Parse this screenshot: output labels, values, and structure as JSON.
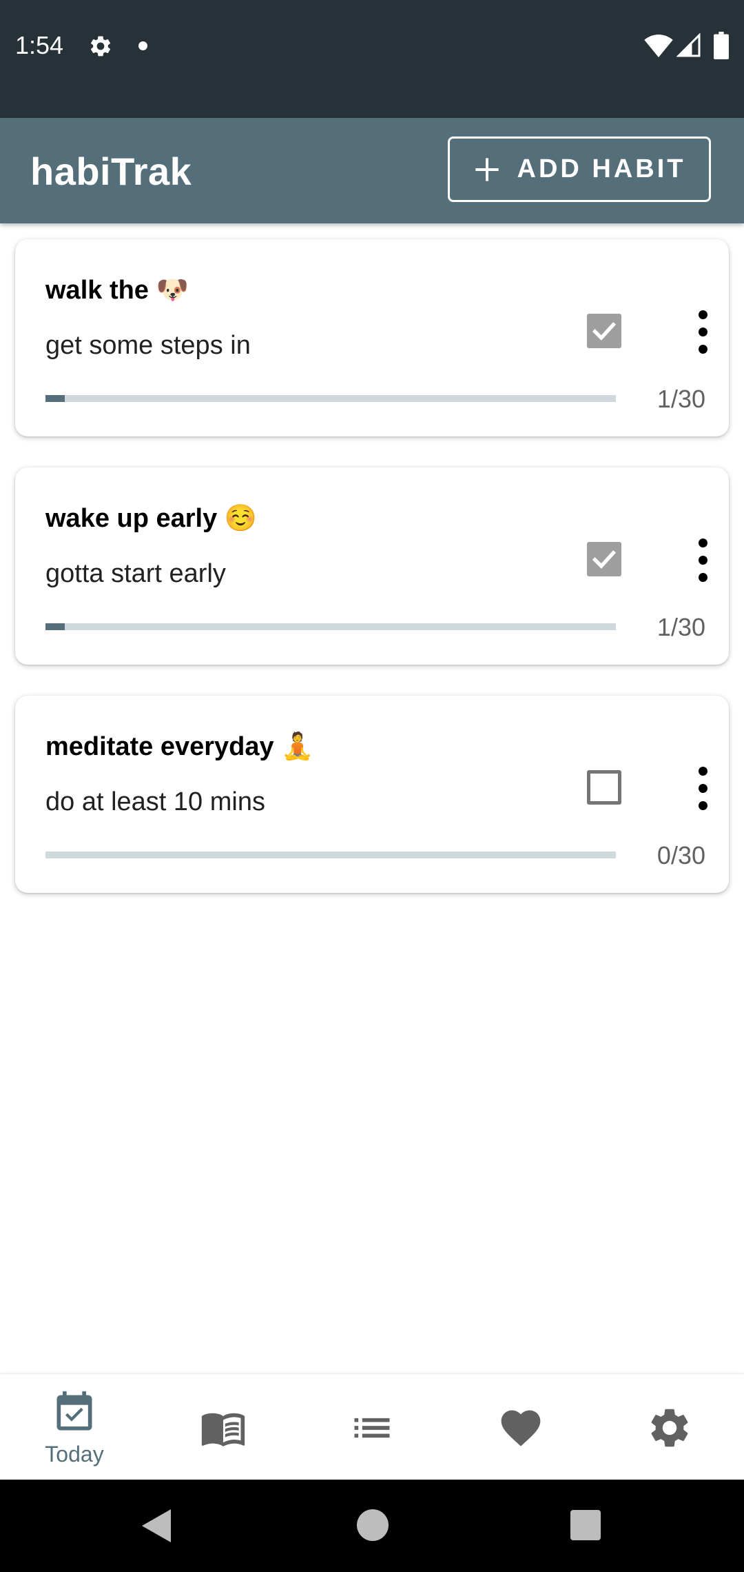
{
  "status_bar": {
    "time": "1:54",
    "icons": [
      "settings-gear-icon",
      "notification-dot-icon",
      "wifi-icon",
      "cell-signal-icon",
      "battery-icon"
    ]
  },
  "app_bar": {
    "title": "habiTrak",
    "add_button_label": "ADD HABIT",
    "background": "#546e7a"
  },
  "habits": [
    {
      "title": "walk the 🐶",
      "description": "get some steps in",
      "checked": true,
      "progress_label": "1/30",
      "progress_value": 1,
      "progress_total": 30
    },
    {
      "title": "wake up early ☺️",
      "description": "gotta start early",
      "checked": true,
      "progress_label": "1/30",
      "progress_value": 1,
      "progress_total": 30
    },
    {
      "title": "meditate everyday 🧘",
      "description": "do at least 10 mins",
      "checked": false,
      "progress_label": "0/30",
      "progress_value": 0,
      "progress_total": 30
    }
  ],
  "bottom_nav": {
    "items": [
      {
        "icon": "calendar-check-icon",
        "label": "Today",
        "active": true
      },
      {
        "icon": "book-icon",
        "label": "",
        "active": false
      },
      {
        "icon": "list-icon",
        "label": "",
        "active": false
      },
      {
        "icon": "heart-icon",
        "label": "",
        "active": false
      },
      {
        "icon": "settings-icon",
        "label": "",
        "active": false
      }
    ],
    "active_color": "#546e7a",
    "inactive_color": "#616161"
  },
  "system_nav": {
    "icons": [
      "back-icon",
      "home-icon",
      "recents-icon"
    ]
  }
}
